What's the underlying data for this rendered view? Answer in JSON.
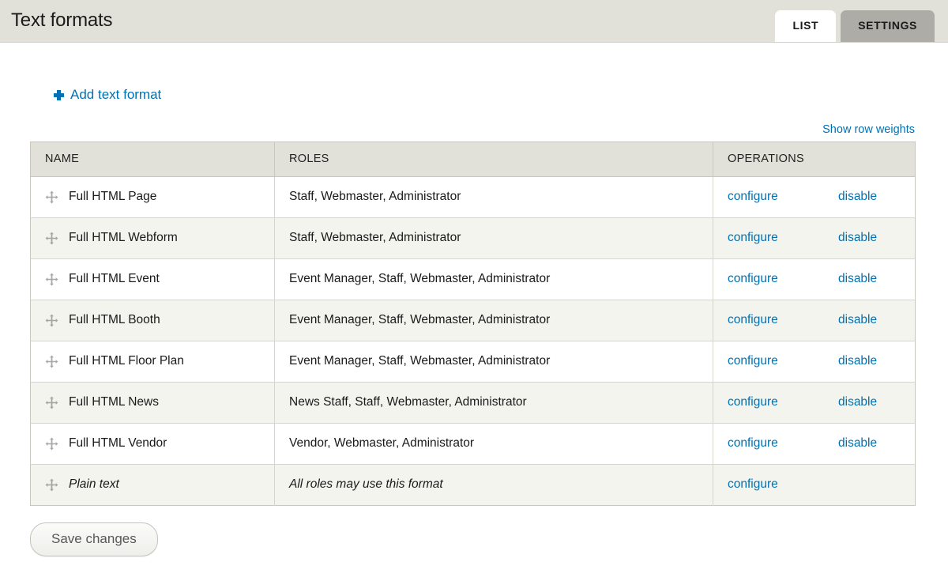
{
  "header": {
    "title": "Text formats",
    "tabs": [
      {
        "label": "LIST",
        "state": "active"
      },
      {
        "label": "SETTINGS",
        "state": "inactive"
      }
    ]
  },
  "toolbar": {
    "add_label": "Add text format",
    "add_icon": "plus-icon",
    "row_weights_label": "Show row weights"
  },
  "table": {
    "columns": [
      "NAME",
      "ROLES",
      "OPERATIONS"
    ],
    "drag_icon": "move-cross-icon",
    "rows": [
      {
        "name": "Full HTML Page",
        "roles": "Staff, Webmaster, Administrator",
        "configure": "configure",
        "disable": "disable",
        "italic": false
      },
      {
        "name": "Full HTML Webform",
        "roles": "Staff, Webmaster, Administrator",
        "configure": "configure",
        "disable": "disable",
        "italic": false
      },
      {
        "name": "Full HTML Event",
        "roles": "Event Manager, Staff, Webmaster, Administrator",
        "configure": "configure",
        "disable": "disable",
        "italic": false
      },
      {
        "name": "Full HTML Booth",
        "roles": "Event Manager, Staff, Webmaster, Administrator",
        "configure": "configure",
        "disable": "disable",
        "italic": false
      },
      {
        "name": "Full HTML Floor Plan",
        "roles": "Event Manager, Staff, Webmaster, Administrator",
        "configure": "configure",
        "disable": "disable",
        "italic": false
      },
      {
        "name": "Full HTML News",
        "roles": "News Staff, Staff, Webmaster, Administrator",
        "configure": "configure",
        "disable": "disable",
        "italic": false
      },
      {
        "name": "Full HTML Vendor",
        "roles": "Vendor, Webmaster, Administrator",
        "configure": "configure",
        "disable": "disable",
        "italic": false
      },
      {
        "name": "Plain text",
        "roles": "All roles may use this format",
        "configure": "configure",
        "disable": "",
        "italic": true
      }
    ]
  },
  "actions": {
    "save_label": "Save changes"
  },
  "colors": {
    "link": "#0071b3",
    "header_bg": "#e2e1d9",
    "tab_inactive_bg": "#adaca6",
    "row_stripe": "#f4f4ee",
    "table_border": "#c8c8c0"
  }
}
